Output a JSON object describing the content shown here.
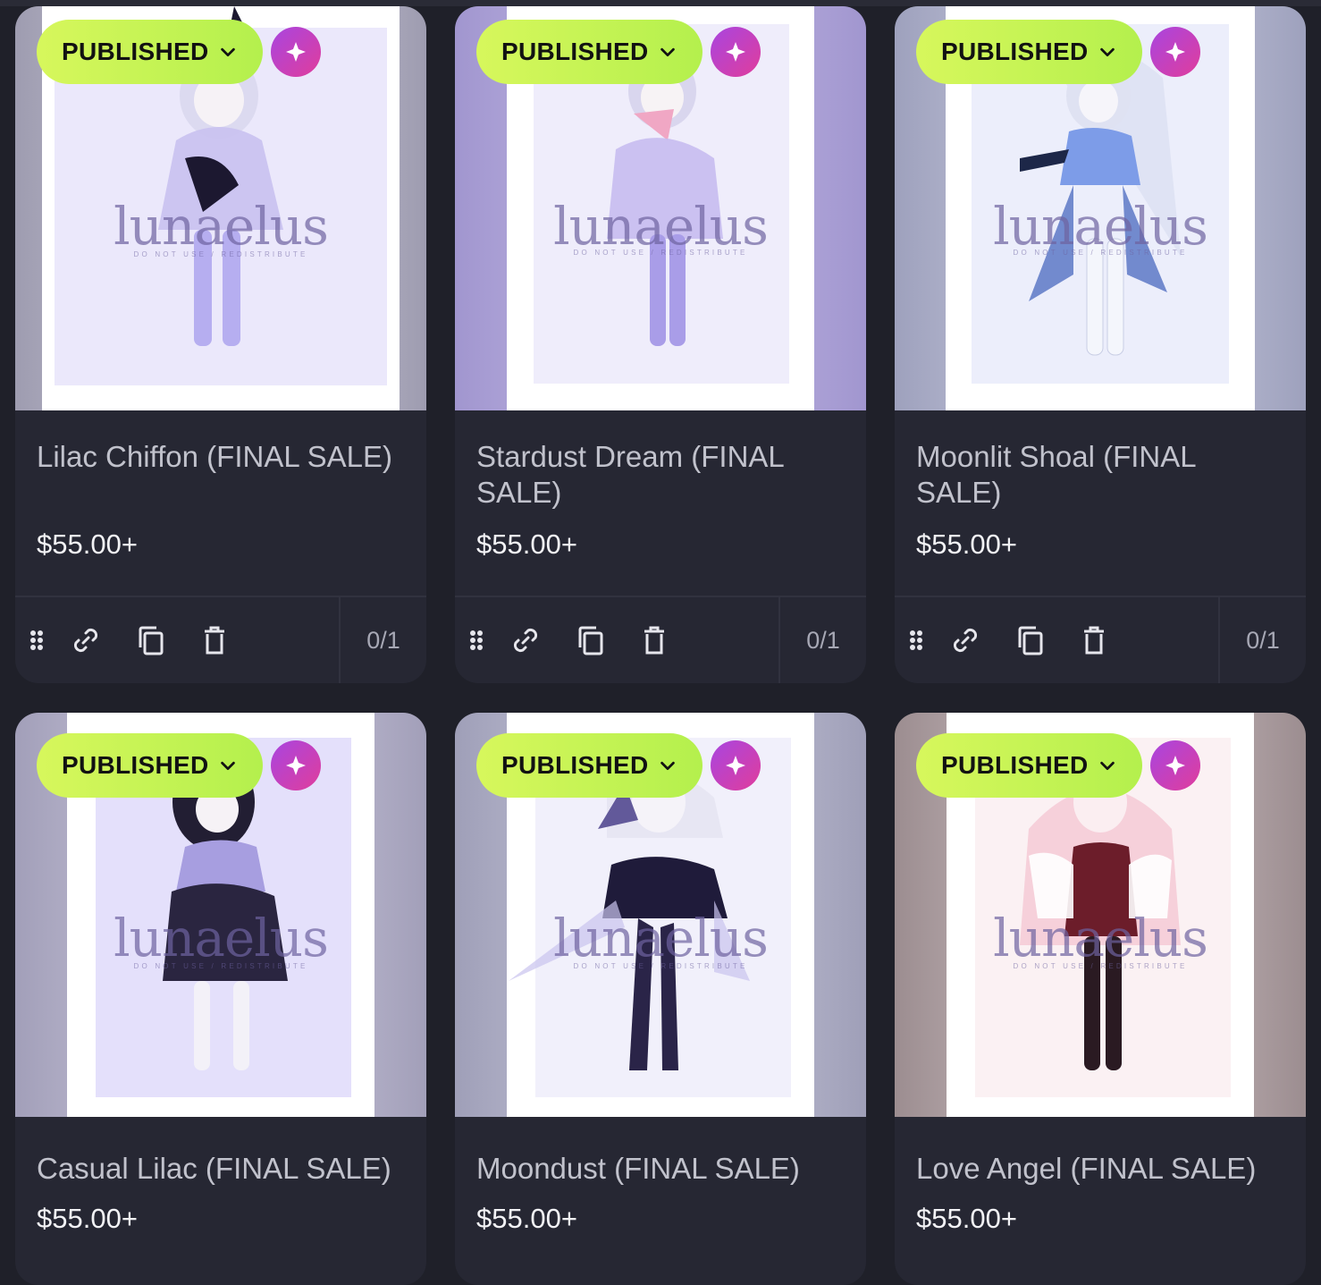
{
  "listings": [
    {
      "status": "PUBLISHED",
      "title": "Lilac Chiffon (FINAL SALE)",
      "price": "$55.00+",
      "stock": "0/1",
      "watermark": "lunaelus",
      "watermark_sub": "DO NOT USE / REDISTRIBUTE",
      "colors": {
        "side": "#b9b7c7",
        "art": "#ebe8fb",
        "dress": "#b3a8ea",
        "accent": "#1c1830"
      }
    },
    {
      "status": "PUBLISHED",
      "title": "Stardust Dream (FINAL SALE)",
      "price": "$55.00+",
      "stock": "0/1",
      "watermark": "lunaelus",
      "watermark_sub": "DO NOT USE / REDISTRIBUTE",
      "colors": {
        "side": "#a99fd1",
        "art": "#efedfb",
        "dress": "#b4a6ec",
        "accent": "#f0a7c4"
      }
    },
    {
      "status": "PUBLISHED",
      "title": "Moonlit Shoal (FINAL SALE)",
      "price": "$55.00+",
      "stock": "0/1",
      "watermark": "lunaelus",
      "watermark_sub": "DO NOT USE / REDISTRIBUTE",
      "colors": {
        "side": "#a6a9c4",
        "art": "#eceefb",
        "dress": "#7d9ce8",
        "accent": "#1d2748"
      }
    },
    {
      "status": "PUBLISHED",
      "title": "Casual Lilac (FINAL SALE)",
      "price": "$55.00+",
      "watermark": "lunaelus",
      "watermark_sub": "DO NOT USE / REDISTRIBUTE",
      "colors": {
        "side": "#aaa7c3",
        "art": "#e4e0fb",
        "dress": "#2a2540",
        "accent": "#a79ee0"
      }
    },
    {
      "status": "PUBLISHED",
      "title": "Moondust (FINAL SALE)",
      "price": "$55.00+",
      "watermark": "lunaelus",
      "watermark_sub": "DO NOT USE / REDISTRIBUTE",
      "colors": {
        "side": "#a7a7bf",
        "art": "#f1f0fb",
        "dress": "#1f1b3a",
        "accent": "#a89ce6"
      }
    },
    {
      "status": "PUBLISHED",
      "title": "Love Angel (FINAL SALE)",
      "price": "$55.00+",
      "watermark": "lunaelus",
      "watermark_sub": "DO NOT USE / REDISTRIBUTE",
      "colors": {
        "side": "#a69596",
        "art": "#fbf1f3",
        "dress": "#6c1d2a",
        "accent": "#f4c4d2"
      }
    }
  ],
  "theme": {
    "background": "#1f2029",
    "card": "#262733",
    "status_green": "#c6f24f",
    "sparkle_gradient": [
      "#a845e0",
      "#e03d9c"
    ]
  },
  "icons": {
    "status_chevron": "chevron-down-icon",
    "sparkle": "sparkle-icon",
    "drag": "drag-handle-icon",
    "link": "link-icon",
    "duplicate": "duplicate-icon",
    "delete": "trash-icon"
  }
}
